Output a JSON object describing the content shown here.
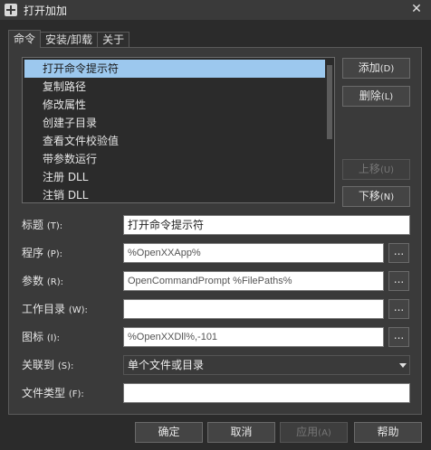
{
  "window": {
    "title": "打开加加",
    "close_glyph": "✕"
  },
  "tabs": [
    {
      "label": "命令",
      "active": true
    },
    {
      "label": "安装/卸载",
      "active": false
    },
    {
      "label": "关于",
      "active": false
    }
  ],
  "commands": [
    {
      "label": "打开命令提示符",
      "selected": true
    },
    {
      "label": "复制路径",
      "selected": false
    },
    {
      "label": "修改属性",
      "selected": false
    },
    {
      "label": "创建子目录",
      "selected": false
    },
    {
      "label": "查看文件校验值",
      "selected": false
    },
    {
      "label": "带参数运行",
      "selected": false
    },
    {
      "label": "注册 DLL",
      "selected": false
    },
    {
      "label": "注销 DLL",
      "selected": false
    }
  ],
  "side_buttons": {
    "add": {
      "label": "添加",
      "accel": "(D)"
    },
    "delete": {
      "label": "删除",
      "accel": "(L)"
    },
    "move_up": {
      "label": "上移",
      "accel": "(U)",
      "disabled": true
    },
    "move_down": {
      "label": "下移",
      "accel": "(N)"
    }
  },
  "form": {
    "title": {
      "label": "标题",
      "accel": "(T):",
      "value": "打开命令提示符"
    },
    "program": {
      "label": "程序",
      "accel": "(P):",
      "value": "%OpenXXApp%"
    },
    "params": {
      "label": "参数",
      "accel": "(R):",
      "value": "OpenCommandPrompt %FilePaths%"
    },
    "workdir": {
      "label": "工作目录",
      "accel": "(W):",
      "value": ""
    },
    "icon": {
      "label": "图标",
      "accel": "(I):",
      "value": "%OpenXXDll%,-101"
    },
    "assoc": {
      "label": "关联到",
      "accel": "(S):",
      "value": "单个文件或目录"
    },
    "filetype": {
      "label": "文件类型",
      "accel": "(F):",
      "value": ""
    },
    "browse_label": "..."
  },
  "bottom_buttons": {
    "ok": {
      "label": "确定",
      "accel": ""
    },
    "cancel": {
      "label": "取消",
      "accel": ""
    },
    "apply": {
      "label": "应用",
      "accel": "(A)",
      "disabled": true
    },
    "help": {
      "label": "帮助",
      "accel": ""
    }
  }
}
